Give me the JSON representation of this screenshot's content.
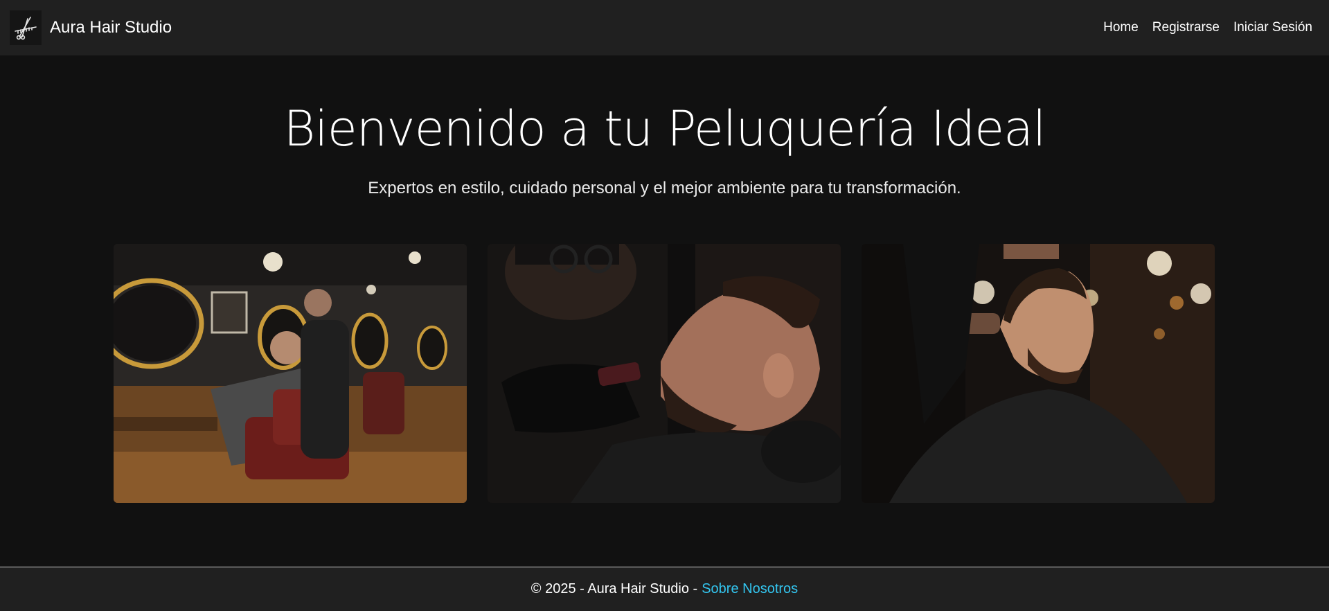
{
  "navbar": {
    "brand_name": "Aura Hair Studio",
    "logo_icon": "scissors-comb-icon",
    "links": [
      {
        "label": "Home"
      },
      {
        "label": "Registrarse"
      },
      {
        "label": "Iniciar Sesión"
      }
    ]
  },
  "hero": {
    "title": "Bienvenido a tu Peluquería Ideal",
    "subtitle": "Expertos en estilo, cuidado personal y el mejor ambiente para tu transformación."
  },
  "gallery": {
    "images": [
      {
        "icon": "barbershop-interior-photo"
      },
      {
        "icon": "beard-trim-photo"
      },
      {
        "icon": "haircut-photo"
      }
    ]
  },
  "footer": {
    "copyright": "© 2025 - Aura Hair Studio -",
    "link_label": "Sobre Nosotros",
    "link_color": "#33c6f0"
  }
}
